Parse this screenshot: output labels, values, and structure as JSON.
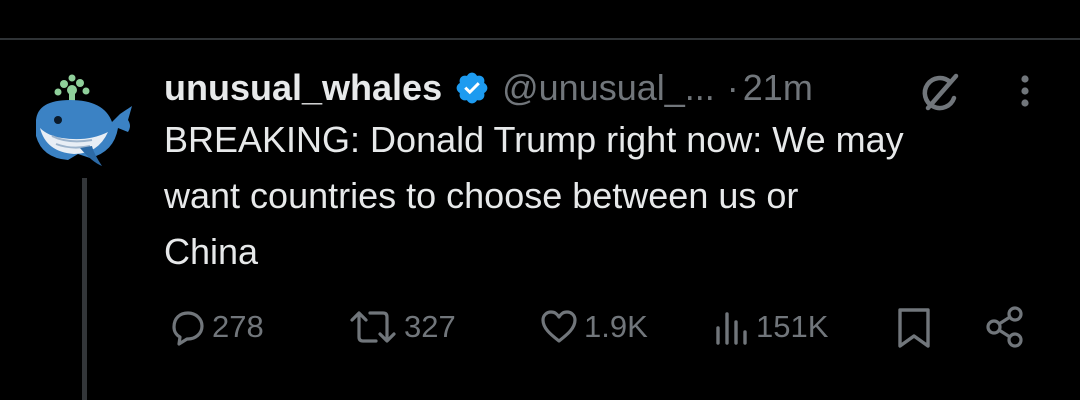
{
  "tweet": {
    "display_name": "unusual_whales",
    "handle": "@unusual_...",
    "separator": "·",
    "time": "21m",
    "text_lines": [
      "BREAKING: Donald Trump right now: We may",
      "want countries to choose between us or",
      "China"
    ]
  },
  "actions": {
    "replies": "278",
    "reposts": "327",
    "likes": "1.9K",
    "views": "151K"
  },
  "icons": {
    "avatar": "whale-avatar-icon",
    "verified": "verified-badge-icon",
    "grok": "grok-icon",
    "more": "more-icon",
    "reply": "reply-icon",
    "repost": "repost-icon",
    "like": "like-icon",
    "views": "views-icon",
    "bookmark": "bookmark-icon",
    "share": "share-icon"
  },
  "colors": {
    "background": "#000000",
    "text": "#e7e9ea",
    "secondary": "#71767b",
    "verified": "#1d9bf0",
    "divider": "#2f3336"
  }
}
